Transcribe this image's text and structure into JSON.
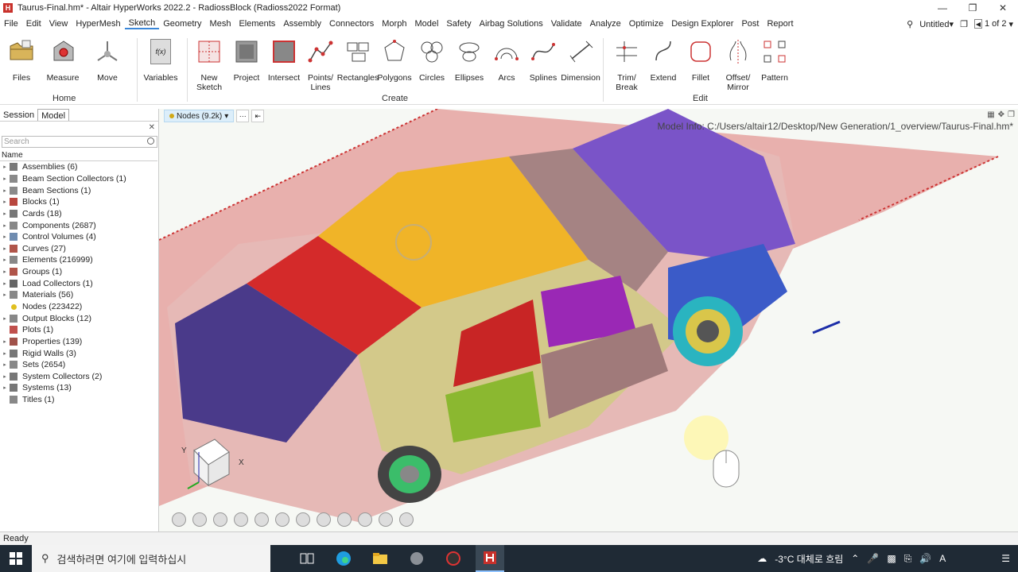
{
  "window": {
    "logo": "H",
    "title": "Taurus-Final.hm* - Altair HyperWorks 2022.2 - RadiossBlock (Radioss2022 Format)"
  },
  "menu": {
    "items": [
      "File",
      "Edit",
      "View",
      "HyperMesh",
      "Sketch",
      "Geometry",
      "Mesh",
      "Elements",
      "Assembly",
      "Connectors",
      "Morph",
      "Model",
      "Safety",
      "Airbag Solutions",
      "Validate",
      "Analyze",
      "Optimize",
      "Design Explorer",
      "Post",
      "Report"
    ],
    "active": "Sketch",
    "session_name": "Untitled",
    "page_indicator": "1 of 2"
  },
  "ribbon": {
    "tools": [
      {
        "label": "Files"
      },
      {
        "label": "Measure"
      },
      {
        "label": "Move"
      },
      {
        "label": "Variables"
      },
      {
        "label": "New\nSketch"
      },
      {
        "label": "Project"
      },
      {
        "label": "Intersect"
      },
      {
        "label": "Points/\nLines"
      },
      {
        "label": "Rectangles"
      },
      {
        "label": "Polygons"
      },
      {
        "label": "Circles"
      },
      {
        "label": "Ellipses"
      },
      {
        "label": "Arcs"
      },
      {
        "label": "Splines"
      },
      {
        "label": "Dimension"
      },
      {
        "label": "Trim/\nBreak"
      },
      {
        "label": "Extend"
      },
      {
        "label": "Fillet"
      },
      {
        "label": "Offset/\nMirror"
      },
      {
        "label": "Pattern"
      }
    ],
    "groups": {
      "home": "Home",
      "create": "Create",
      "edit": "Edit"
    },
    "variables_glyph": "f(x)"
  },
  "panel": {
    "tabs": [
      "Session",
      "Model"
    ],
    "active_tab": "Model",
    "search_placeholder": "Search",
    "column_header": "Name",
    "items": [
      {
        "label": "Assemblies  (6)",
        "color": "#7a7a7a"
      },
      {
        "label": "Beam Section Collectors  (1)",
        "color": "#8a8a8a"
      },
      {
        "label": "Beam Sections  (1)",
        "color": "#8a8a8a"
      },
      {
        "label": "Blocks  (1)",
        "color": "#b8473f"
      },
      {
        "label": "Cards  (18)",
        "color": "#777777"
      },
      {
        "label": "Components  (2687)",
        "color": "#888888"
      },
      {
        "label": "Control Volumes  (4)",
        "color": "#6f8cb0"
      },
      {
        "label": "Curves  (27)",
        "color": "#b0554a"
      },
      {
        "label": "Elements  (216999)",
        "color": "#888888"
      },
      {
        "label": "Groups  (1)",
        "color": "#b0554a"
      },
      {
        "label": "Load Collectors  (1)",
        "color": "#666666"
      },
      {
        "label": "Materials  (56)",
        "color": "#888888"
      },
      {
        "label": "Nodes  (223422)",
        "color": "#e0c020"
      },
      {
        "label": "Output Blocks  (12)",
        "color": "#888888"
      },
      {
        "label": "Plots  (1)",
        "color": "#c0504d"
      },
      {
        "label": "Properties  (139)",
        "color": "#a0524a"
      },
      {
        "label": "Rigid Walls  (3)",
        "color": "#777777"
      },
      {
        "label": "Sets  (2654)",
        "color": "#888888"
      },
      {
        "label": "System Collectors  (2)",
        "color": "#777777"
      },
      {
        "label": "Systems  (13)",
        "color": "#777777"
      },
      {
        "label": "Titles  (1)",
        "color": "#888888"
      }
    ]
  },
  "viewport": {
    "selector_label": "Nodes (9.2k)",
    "model_info": "Model Info: C:/Users/altair12/Desktop/New Generation/1_overview/Taurus-Final.hm*",
    "axis_labels": {
      "y": "Y",
      "x": "X"
    }
  },
  "status": {
    "text": "Ready"
  },
  "taskbar": {
    "search_placeholder": "검색하려면 여기에 입력하십시",
    "weather": "-3°C  대체로 흐림",
    "ime": "A"
  }
}
